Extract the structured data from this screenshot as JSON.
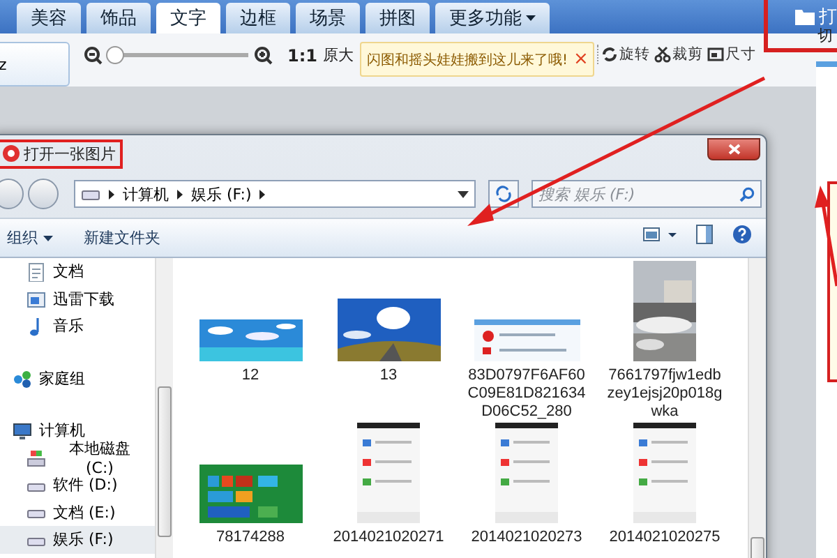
{
  "app_tabs": [
    {
      "label": "美容",
      "selected": false
    },
    {
      "label": "饰品",
      "selected": false
    },
    {
      "label": "文字",
      "selected": true
    },
    {
      "label": "边框",
      "selected": false
    },
    {
      "label": "场景",
      "selected": false
    },
    {
      "label": "拼图",
      "selected": false
    },
    {
      "label": "更多功能",
      "selected": false,
      "dropdown": true
    }
  ],
  "open_button": {
    "label": "打"
  },
  "toolbar": {
    "left_button": "z",
    "zoom": {
      "level": 0
    },
    "zoom_reading": "1:1",
    "actual_size": "原大",
    "tooltip": {
      "text": "闪图和摇头娃娃搬到这儿来了哦!",
      "close": "×"
    },
    "tools": [
      {
        "label": "旋转",
        "kind": "rotate"
      },
      {
        "label": "裁剪",
        "kind": "crop"
      },
      {
        "label": "尺寸",
        "kind": "resize"
      }
    ],
    "switch": "切"
  },
  "dialog": {
    "title": "打开一张图片",
    "path": [
      "计算机",
      "娱乐 (F:)"
    ],
    "search": {
      "placeholder": "搜索 娱乐 (F:)"
    },
    "commands": [
      {
        "label": "组织",
        "dropdown": true
      },
      {
        "label": "新建文件夹",
        "dropdown": false
      }
    ],
    "nav": [
      {
        "children": [
          {
            "label": "文档",
            "kind": "document",
            "selected": false
          },
          {
            "label": "迅雷下载",
            "kind": "download",
            "selected": false
          },
          {
            "label": "音乐",
            "kind": "music",
            "selected": false
          }
        ]
      },
      {
        "label": "家庭组",
        "kind": "homegroup",
        "selected": false
      },
      {
        "label": "计算机",
        "kind": "computer",
        "selected": false,
        "children": [
          {
            "label": "本地磁盘 (C:)",
            "kind": "system-disk",
            "selected": false
          },
          {
            "label": "软件 (D:)",
            "kind": "disk",
            "selected": false
          },
          {
            "label": "文档 (E:)",
            "kind": "disk",
            "selected": false
          },
          {
            "label": "娱乐 (F:)",
            "kind": "disk",
            "selected": true
          }
        ]
      }
    ],
    "files": [
      {
        "name": "12",
        "kind": "picture"
      },
      {
        "name": "13",
        "kind": "picture"
      },
      {
        "name": "83D0797F6AF60C09E81D821634D06C52_280",
        "kind": "picture"
      },
      {
        "name": "7661797fjw1edbzey1ejsj20p018gwka",
        "kind": "picture"
      },
      {
        "name": "78174288",
        "kind": "picture"
      },
      {
        "name": "2014021020271",
        "kind": "picture"
      },
      {
        "name": "2014021020273",
        "kind": "picture"
      },
      {
        "name": "2014021020275",
        "kind": "picture"
      }
    ]
  }
}
